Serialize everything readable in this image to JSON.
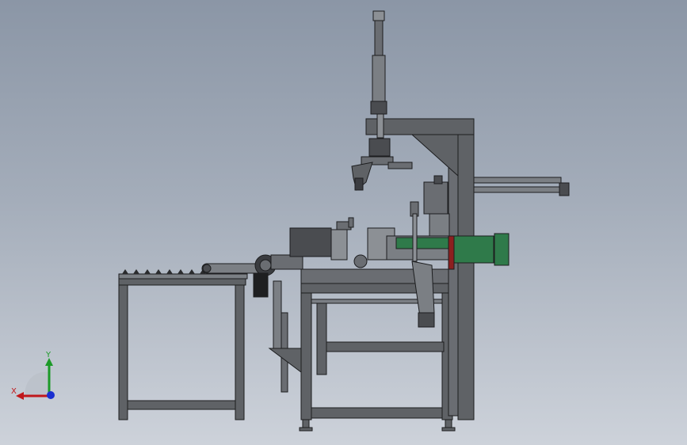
{
  "viewport": {
    "background_top": "#8b96a6",
    "background_bottom": "#cdd2da"
  },
  "triad": {
    "x_label": "X",
    "y_label": "Y",
    "x_color": "#c0181c",
    "y_color": "#1c9a28",
    "z_color": "#1a2fd0"
  },
  "model": {
    "frame_color": "#5f6266",
    "outline_color": "#1c1d1f",
    "cylinder_color": "#2f7a4a",
    "accent_color": "#8c1f1f",
    "part_color": "#7b7f84"
  }
}
